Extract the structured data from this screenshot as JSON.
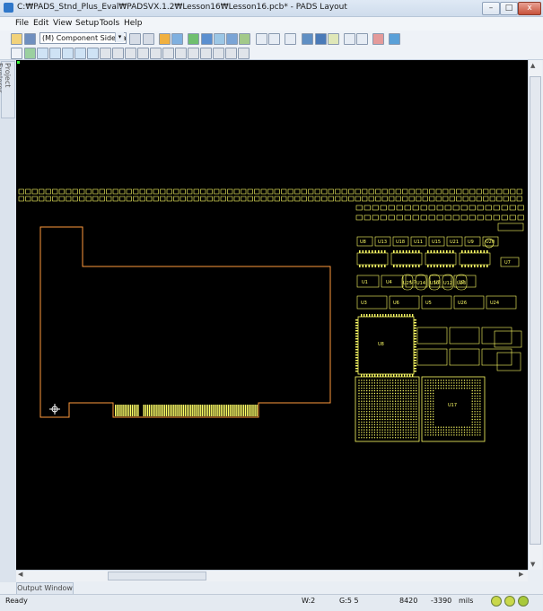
{
  "window": {
    "title": "C:₩PADS_Stnd_Plus_Eval₩PADSVX.1.2₩Lesson16₩Lesson16.pcb* - PADS Layout",
    "minimize": "–",
    "maximize": "□",
    "close": "x"
  },
  "menu": [
    {
      "label": "File"
    },
    {
      "label": "Edit"
    },
    {
      "label": "View"
    },
    {
      "label": "Setup"
    },
    {
      "label": "Tools"
    },
    {
      "label": "Help"
    }
  ],
  "toolbar": {
    "layer_select": "(M) Component Side Layer",
    "layer_select_arrow": "▾"
  },
  "side_panel": {
    "project_explorer": "Project Explorer"
  },
  "output_tab": "Output Window",
  "status": {
    "text": "Ready",
    "width": "W:2",
    "grid": "G:5 5",
    "x": "8420",
    "y": "-3390",
    "units": "mils"
  },
  "parts": {
    "row1": [
      "U8",
      "U13",
      "U18",
      "U11",
      "U15",
      "U21",
      "U9",
      "U20"
    ],
    "row2": [
      "U1",
      "U4",
      "U7",
      "U3",
      "U2"
    ],
    "row3": [
      "U25",
      "U14",
      "U10",
      "U12",
      "U23"
    ],
    "row4": [
      "U3",
      "U6",
      "U5",
      "U26",
      "U24"
    ],
    "bga": [
      "U8",
      "U17"
    ],
    "misc": [
      "U7"
    ]
  },
  "colors": {
    "board_outline": "#ff9a3c",
    "component": "#ffff66",
    "text": "#ffff66",
    "accent": "#2f77c9"
  }
}
